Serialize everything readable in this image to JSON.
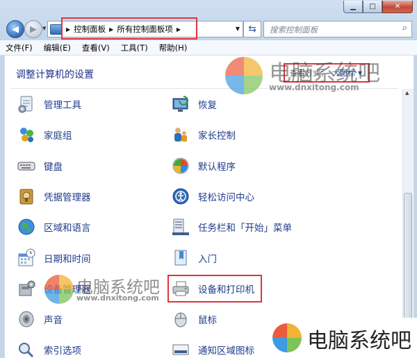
{
  "window": {
    "caption_buttons": [
      "minimize",
      "maximize",
      "close"
    ]
  },
  "address_bar": {
    "crumbs": [
      "控制面板",
      "所有控制面板项"
    ]
  },
  "search": {
    "placeholder": "搜索控制面板"
  },
  "menu": [
    "文件(F)",
    "编辑(E)",
    "查看(V)",
    "工具(T)",
    "帮助(H)"
  ],
  "header": {
    "title": "调整计算机的设置",
    "view_by_label": "查看方式：",
    "view_by_value": "大图标"
  },
  "items_left": [
    {
      "label": "管理工具",
      "icon": "admin-tools-icon"
    },
    {
      "label": "家庭组",
      "icon": "homegroup-icon"
    },
    {
      "label": "键盘",
      "icon": "keyboard-icon"
    },
    {
      "label": "凭据管理器",
      "icon": "credential-manager-icon"
    },
    {
      "label": "区域和语言",
      "icon": "region-language-icon"
    },
    {
      "label": "日期和时间",
      "icon": "date-time-icon"
    },
    {
      "label": "设备管理器",
      "icon": "device-manager-icon"
    },
    {
      "label": "声音",
      "icon": "sound-icon"
    },
    {
      "label": "索引选项",
      "icon": "indexing-options-icon"
    }
  ],
  "items_right": [
    {
      "label": "恢复",
      "icon": "recovery-icon"
    },
    {
      "label": "家长控制",
      "icon": "parental-controls-icon"
    },
    {
      "label": "默认程序",
      "icon": "default-programs-icon"
    },
    {
      "label": "轻松访问中心",
      "icon": "ease-of-access-icon"
    },
    {
      "label": "任务栏和「开始」菜单",
      "icon": "taskbar-start-menu-icon"
    },
    {
      "label": "入门",
      "icon": "getting-started-icon"
    },
    {
      "label": "设备和打印机",
      "icon": "devices-printers-icon"
    },
    {
      "label": "鼠标",
      "icon": "mouse-icon"
    },
    {
      "label": "通知区域图标",
      "icon": "notification-area-icons-icon"
    }
  ],
  "watermark": {
    "brand": "电脑系统吧",
    "url": "www.dnxitong.com"
  },
  "colors": {
    "link": "#1f3c8c",
    "heading": "#1e3287",
    "highlight": "#e0333b"
  }
}
